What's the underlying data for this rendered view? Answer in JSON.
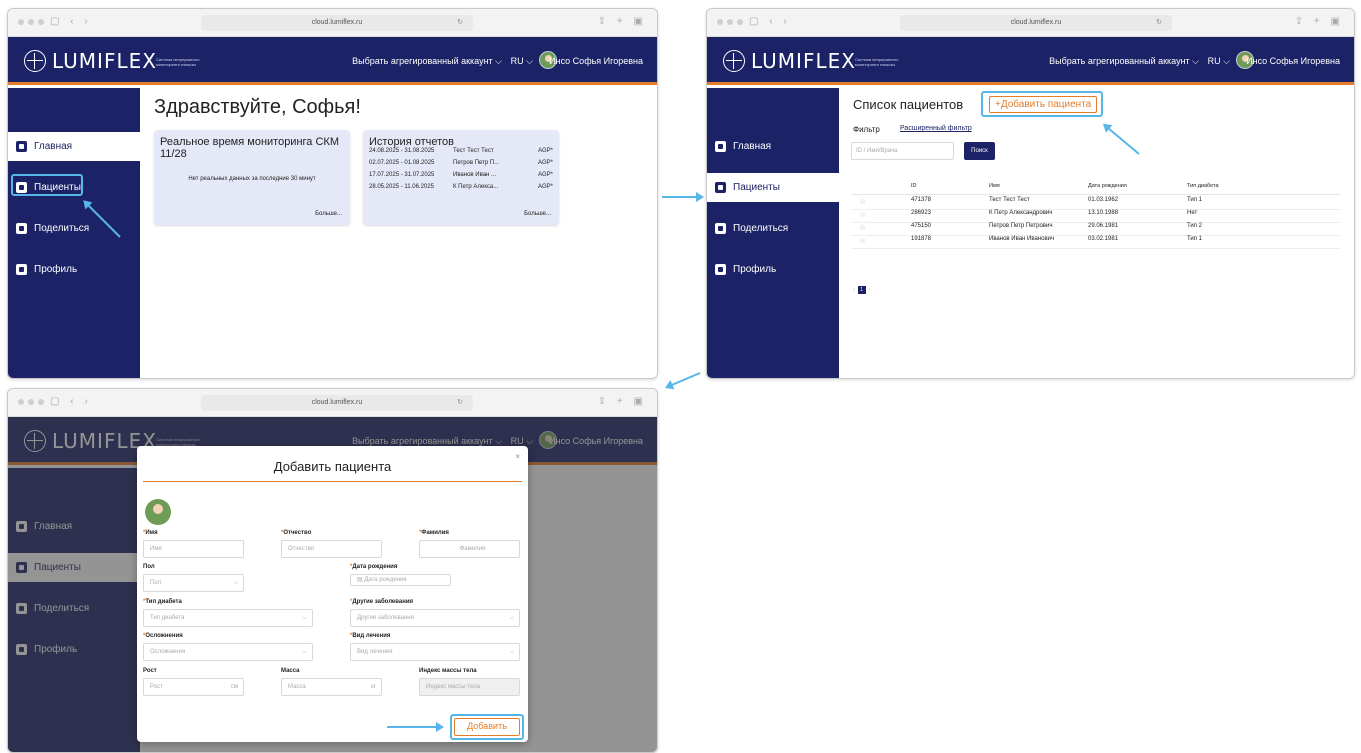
{
  "browser": {
    "url": "cloud.lumiflex.ru"
  },
  "app": {
    "logo_text": "LUMIFLEX",
    "tagline": "Система непрерывного мониторинга глюкозы",
    "account_selector": "Выбрать агрегированный аккаунт ⌵",
    "language": "RU ⌵",
    "user_name": "Инсо Софья Игоревна"
  },
  "sidebar": {
    "items": [
      {
        "label": "Главная"
      },
      {
        "label": "Пациенты"
      },
      {
        "label": "Поделиться"
      },
      {
        "label": "Профиль"
      }
    ]
  },
  "home": {
    "greeting": "Здравствуйте, Софья!",
    "realtime_card": {
      "title": "Реальное время мониторинга СКМ 11/28",
      "no_data": "Нет реальных данных за последние 30 минут",
      "more": "Больше..."
    },
    "history_card": {
      "title": "История отчетов",
      "rows": [
        {
          "dates": "24.08.2025 - 31.08.2025",
          "name": "Тест Тест Тест",
          "type": "AGP*"
        },
        {
          "dates": "02.07.2025 - 01.08.2025",
          "name": "Петров Петр П...",
          "type": "AGP*"
        },
        {
          "dates": "17.07.2025 - 31.07.2025",
          "name": "Иванов Иван ...",
          "type": "AGP*"
        },
        {
          "dates": "28.05.2025 - 11.06.2025",
          "name": "К Петр Алекса...",
          "type": "AGP*"
        }
      ],
      "more": "Больше..."
    }
  },
  "patients": {
    "title": "Список пациентов",
    "add_button": "+Добавить пациента",
    "filter_label": "Фильтр",
    "extended_filter": "Расширенный фильтр",
    "search_placeholder": "ID / Имя/Врача",
    "search_button": "Поиск",
    "columns": [
      "ID",
      "Имя",
      "Дата рождения",
      "Тип диабета"
    ],
    "rows": [
      {
        "id": "471378",
        "name": "Тест Тест Тест",
        "dob": "01.03.1962",
        "type": "Тип 1"
      },
      {
        "id": "286923",
        "name": "К Петр Александрович",
        "dob": "13.10.1988",
        "type": "Нет"
      },
      {
        "id": "475150",
        "name": "Петров Петр Петрович",
        "dob": "29.06.1981",
        "type": "Тип 2"
      },
      {
        "id": "191878",
        "name": "Иванов Иван Иванович",
        "dob": "03.02.1981",
        "type": "Тип 1"
      }
    ],
    "pager": {
      "prev": "‹",
      "page": "1",
      "next": "›"
    }
  },
  "modal": {
    "title": "Добавить пациента",
    "close": "×",
    "fields": {
      "first_name": {
        "label": "Имя",
        "placeholder": "Имя"
      },
      "patronymic": {
        "label": "Отчество",
        "placeholder": "Отчество"
      },
      "last_name": {
        "label": "Фамилия",
        "placeholder": "Фамилия"
      },
      "sex": {
        "label": "Пол",
        "placeholder": "Пол"
      },
      "dob": {
        "label": "Дата рождения",
        "placeholder": "Дата рождения"
      },
      "diabetes_type": {
        "label": "Тип диабета",
        "placeholder": "Тип диабета"
      },
      "other_diseases": {
        "label": "Другие заболевания",
        "placeholder": "Другие заболевания"
      },
      "complications": {
        "label": "Осложнения",
        "placeholder": "Осложнения"
      },
      "treatment": {
        "label": "Вид лечения",
        "placeholder": "Вид лечения"
      },
      "height": {
        "label": "Рост",
        "placeholder": "Рост",
        "unit": "см"
      },
      "weight": {
        "label": "Масса",
        "placeholder": "Масса",
        "unit": "кг"
      },
      "bmi": {
        "label": "Индекс массы тела",
        "placeholder": "Индекс массы тела"
      }
    },
    "required_mark": "*",
    "submit": "Добавить"
  },
  "colors": {
    "navy": "#1b2265",
    "accent_orange": "#e37d2a",
    "highlight_blue": "#56b6e8"
  }
}
